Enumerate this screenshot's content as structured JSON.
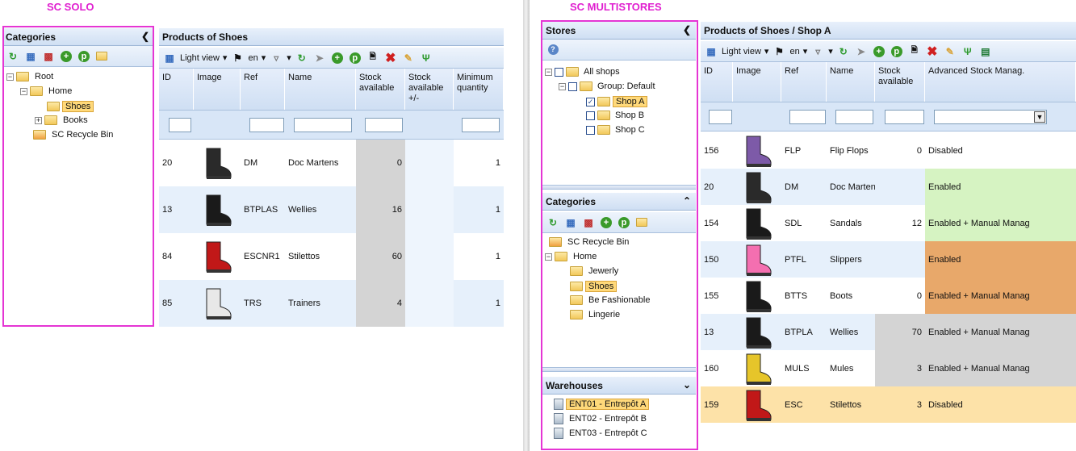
{
  "labels": {
    "solo": "SC SOLO",
    "multi": "SC MULTISTORES"
  },
  "solo": {
    "categories_title": "Categories",
    "tree": [
      {
        "label": "Root"
      },
      {
        "label": "Home"
      },
      {
        "label": "Shoes"
      },
      {
        "label": "Books"
      },
      {
        "label": "SC Recycle Bin"
      }
    ],
    "products_title": "Products of Shoes",
    "toolbar": {
      "view": "Light view",
      "lang": "en"
    },
    "columns": [
      "ID",
      "Image",
      "Ref",
      "Name",
      "Stock available",
      "Stock available +/-",
      "Minimum quantity"
    ],
    "rows": [
      {
        "id": "20",
        "ref": "DM",
        "name": "Doc Martens",
        "stock": "0",
        "min": "1"
      },
      {
        "id": "13",
        "ref": "BTPLAS",
        "name": "Wellies",
        "stock": "16",
        "min": "1"
      },
      {
        "id": "84",
        "ref": "ESCNR1",
        "name": "Stilettos",
        "stock": "60",
        "min": "1"
      },
      {
        "id": "85",
        "ref": "TRS",
        "name": "Trainers",
        "stock": "4",
        "min": "1"
      }
    ]
  },
  "multi": {
    "stores_title": "Stores",
    "stores": [
      {
        "label": "All shops"
      },
      {
        "label": "Group: Default"
      },
      {
        "label": "Shop A",
        "checked": true
      },
      {
        "label": "Shop B"
      },
      {
        "label": "Shop C"
      }
    ],
    "categories_title": "Categories",
    "categories": [
      {
        "label": "SC Recycle Bin"
      },
      {
        "label": "Home"
      },
      {
        "label": "Jewerly"
      },
      {
        "label": "Shoes"
      },
      {
        "label": "Be Fashionable"
      },
      {
        "label": "Lingerie"
      }
    ],
    "warehouses_title": "Warehouses",
    "warehouses": [
      {
        "label": "ENT01 - Entrepôt A"
      },
      {
        "label": "ENT02 - Entrepôt B"
      },
      {
        "label": "ENT03 - Entrepôt C"
      }
    ],
    "products_title": "Products of Shoes / Shop A",
    "toolbar": {
      "view": "Light view",
      "lang": "en"
    },
    "columns": [
      "ID",
      "Image",
      "Ref",
      "Name",
      "Stock available",
      "Advanced Stock Manag."
    ],
    "rows": [
      {
        "id": "156",
        "ref": "FLP",
        "name": "Flip Flops",
        "stock": "0",
        "adv": "Disabled",
        "bg": "#ffffff",
        "advbg": "#ffffff"
      },
      {
        "id": "20",
        "ref": "DM",
        "name": "Doc Martens",
        "stock": "",
        "adv": "Enabled",
        "bg": "#e6f0fb",
        "advbg": "#d6f3c2"
      },
      {
        "id": "154",
        "ref": "SDL",
        "name": "Sandals",
        "stock": "12",
        "adv": "Enabled + Manual Manag",
        "bg": "#ffffff",
        "advbg": "#d6f3c2"
      },
      {
        "id": "150",
        "ref": "PTFL",
        "name": "Slippers",
        "stock": "",
        "adv": "Enabled",
        "bg": "#e6f0fb",
        "advbg": "#e8a86a"
      },
      {
        "id": "155",
        "ref": "BTTS",
        "name": "Boots",
        "stock": "0",
        "adv": "Enabled + Manual Manag",
        "bg": "#ffffff",
        "advbg": "#e8a86a"
      },
      {
        "id": "13",
        "ref": "BTPLA",
        "name": "Wellies",
        "stock": "70",
        "adv": "Enabled + Manual Manag",
        "bg": "#e6f0fb",
        "advbg": "#d4d4d4"
      },
      {
        "id": "160",
        "ref": "MULS",
        "name": "Mules",
        "stock": "3",
        "adv": "Enabled + Manual Manag",
        "bg": "#ffffff",
        "advbg": "#d4d4d4"
      },
      {
        "id": "159",
        "ref": "ESC",
        "name": "Stilettos",
        "stock": "3",
        "adv": "Disabled",
        "bg": "#fde2a8",
        "advbg": "#fde2a8"
      }
    ]
  }
}
